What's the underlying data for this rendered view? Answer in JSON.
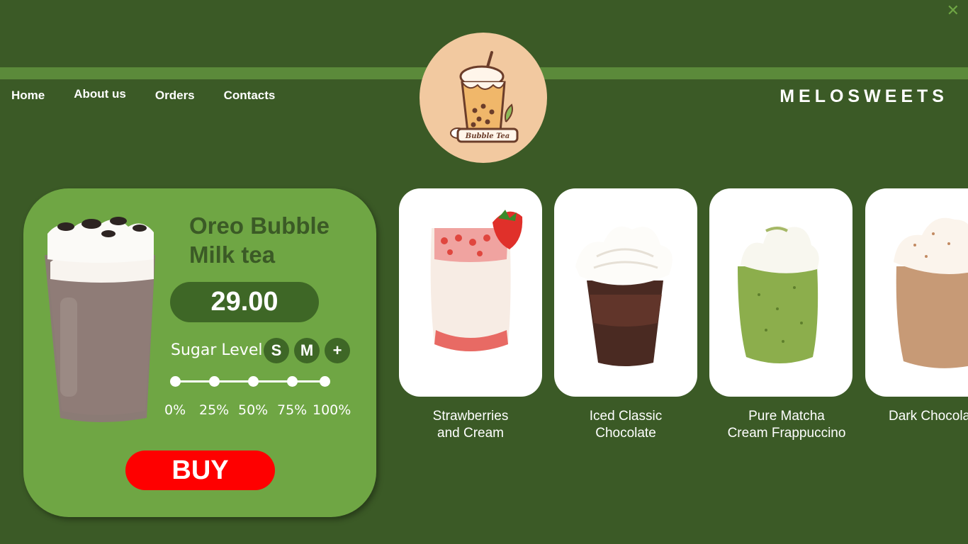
{
  "window": {
    "close_icon": "close-icon"
  },
  "nav": {
    "items": [
      {
        "label": "Home"
      },
      {
        "label": "About us"
      },
      {
        "label": "Orders"
      },
      {
        "label": "Contacts"
      }
    ]
  },
  "logo": {
    "text": "Bubble Tea",
    "icon": "bubble-tea-cup-icon"
  },
  "brand": {
    "name": "MELOSWEETS"
  },
  "featured": {
    "name": "Oreo Bubble Milk tea",
    "price": "29.00",
    "sugar_label": "Sugar Level",
    "sizes": [
      "S",
      "M",
      "+"
    ],
    "sugar_ticks": [
      "0%",
      "25%",
      "50%",
      "75%",
      "100%"
    ],
    "buy_label": "BUY"
  },
  "menu": {
    "items": [
      {
        "label": "Strawberries\nand Cream"
      },
      {
        "label": "Iced Classic\nChocolate"
      },
      {
        "label": "Pure Matcha\nCream Frappuccino"
      },
      {
        "label": "Dark Chocolate"
      }
    ]
  },
  "colors": {
    "background": "#3b5a26",
    "band": "#5b8a3a",
    "card": "#6fa644",
    "pill": "#3e6726",
    "buy": "#fe0000",
    "logo_bg": "#f2c9a0"
  }
}
